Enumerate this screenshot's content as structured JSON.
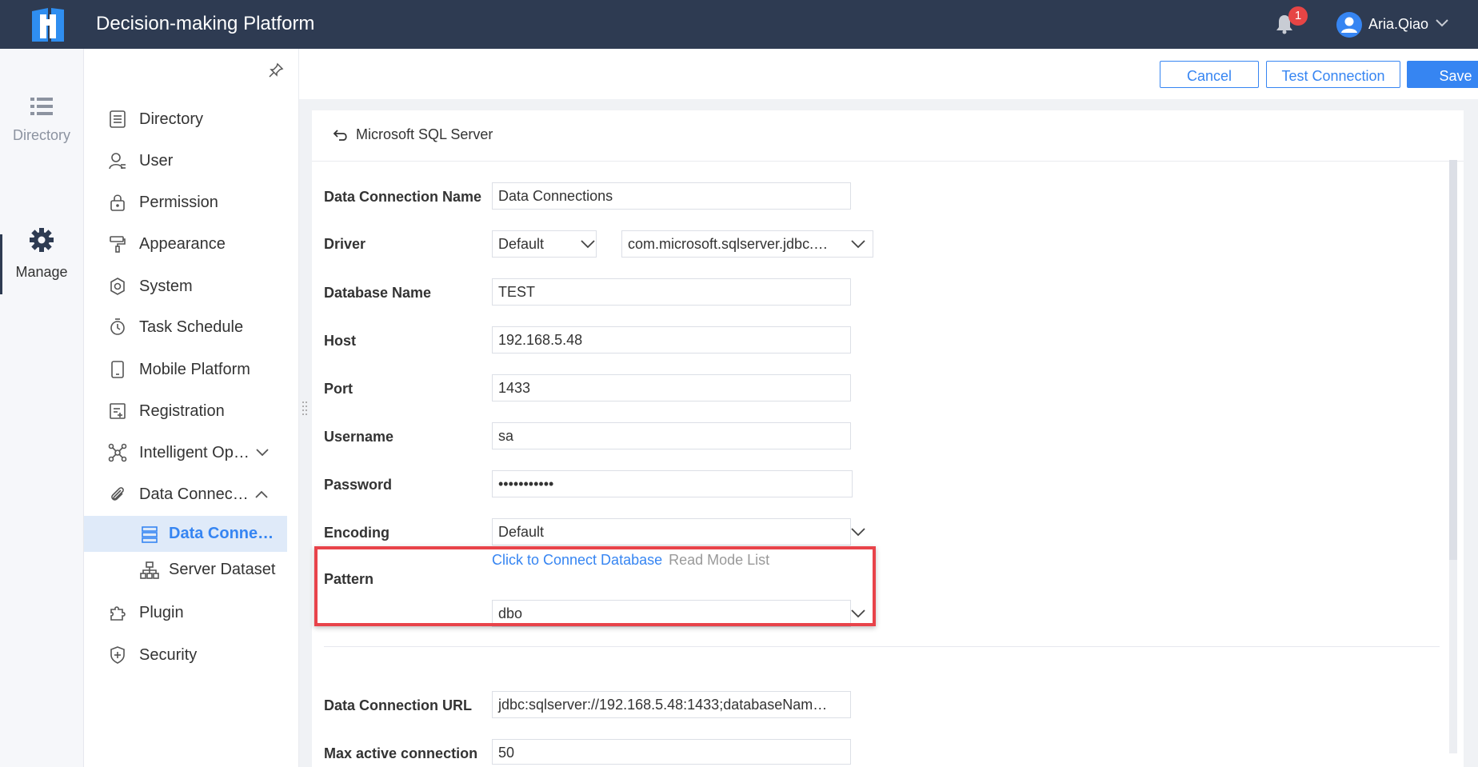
{
  "app": {
    "title": "Decision-making Platform"
  },
  "header": {
    "notification_count": "1",
    "username": "Aria.Qiao"
  },
  "rail": {
    "items": [
      {
        "label": "Directory",
        "icon": "list-icon"
      },
      {
        "label": "Manage",
        "icon": "gear-icon",
        "active": true
      }
    ]
  },
  "menu": {
    "items": [
      {
        "label": "Directory",
        "icon": "directory-icon"
      },
      {
        "label": "User",
        "icon": "user-icon"
      },
      {
        "label": "Permission",
        "icon": "lock-icon"
      },
      {
        "label": "Appearance",
        "icon": "paint-roller-icon"
      },
      {
        "label": "System",
        "icon": "settings-icon"
      },
      {
        "label": "Task Schedule",
        "icon": "timer-icon"
      },
      {
        "label": "Mobile Platform",
        "icon": "mobile-icon"
      },
      {
        "label": "Registration",
        "icon": "registration-icon"
      },
      {
        "label": "Intelligent Op…",
        "icon": "network-icon",
        "caret": "down"
      },
      {
        "label": "Data Connec…",
        "icon": "paperclip-icon",
        "caret": "up"
      },
      {
        "label": "Plugin",
        "icon": "puzzle-icon"
      },
      {
        "label": "Security",
        "icon": "shield-icon"
      }
    ],
    "subitems": [
      {
        "label": "Data Conne…",
        "icon": "database-icon",
        "active": true
      },
      {
        "label": "Server Dataset",
        "icon": "sitemap-icon"
      }
    ]
  },
  "toolbar": {
    "cancel_label": "Cancel",
    "test_label": "Test Connection",
    "save_label": "Save"
  },
  "form": {
    "title": "Microsoft SQL Server",
    "connection_name_label": "Data Connection Name",
    "connection_name_value": "Data Connections",
    "driver_label": "Driver",
    "driver_type_value": "Default",
    "driver_class_value": "com.microsoft.sqlserver.jdbc.…",
    "database_name_label": "Database Name",
    "database_name_value": "TEST",
    "host_label": "Host",
    "host_value": "192.168.5.48",
    "port_label": "Port",
    "port_value": "1433",
    "username_label": "Username",
    "username_value": "sa",
    "password_label": "Password",
    "password_value": "•••••••••••",
    "encoding_label": "Encoding",
    "encoding_value": "Default",
    "pattern_label": "Pattern",
    "pattern_connect_link": "Click to Connect Database",
    "pattern_read_link": "Read Mode List",
    "pattern_value": "dbo",
    "url_label": "Data Connection URL",
    "url_value": "jdbc:sqlserver://192.168.5.48:1433;databaseNam…",
    "max_active_label": "Max active connection",
    "max_active_value": "50"
  },
  "colors": {
    "topbar": "#2e3b52",
    "accent": "#3685f2",
    "highlight": "#e8434a",
    "active_menu_bg": "#dfeaf9"
  }
}
